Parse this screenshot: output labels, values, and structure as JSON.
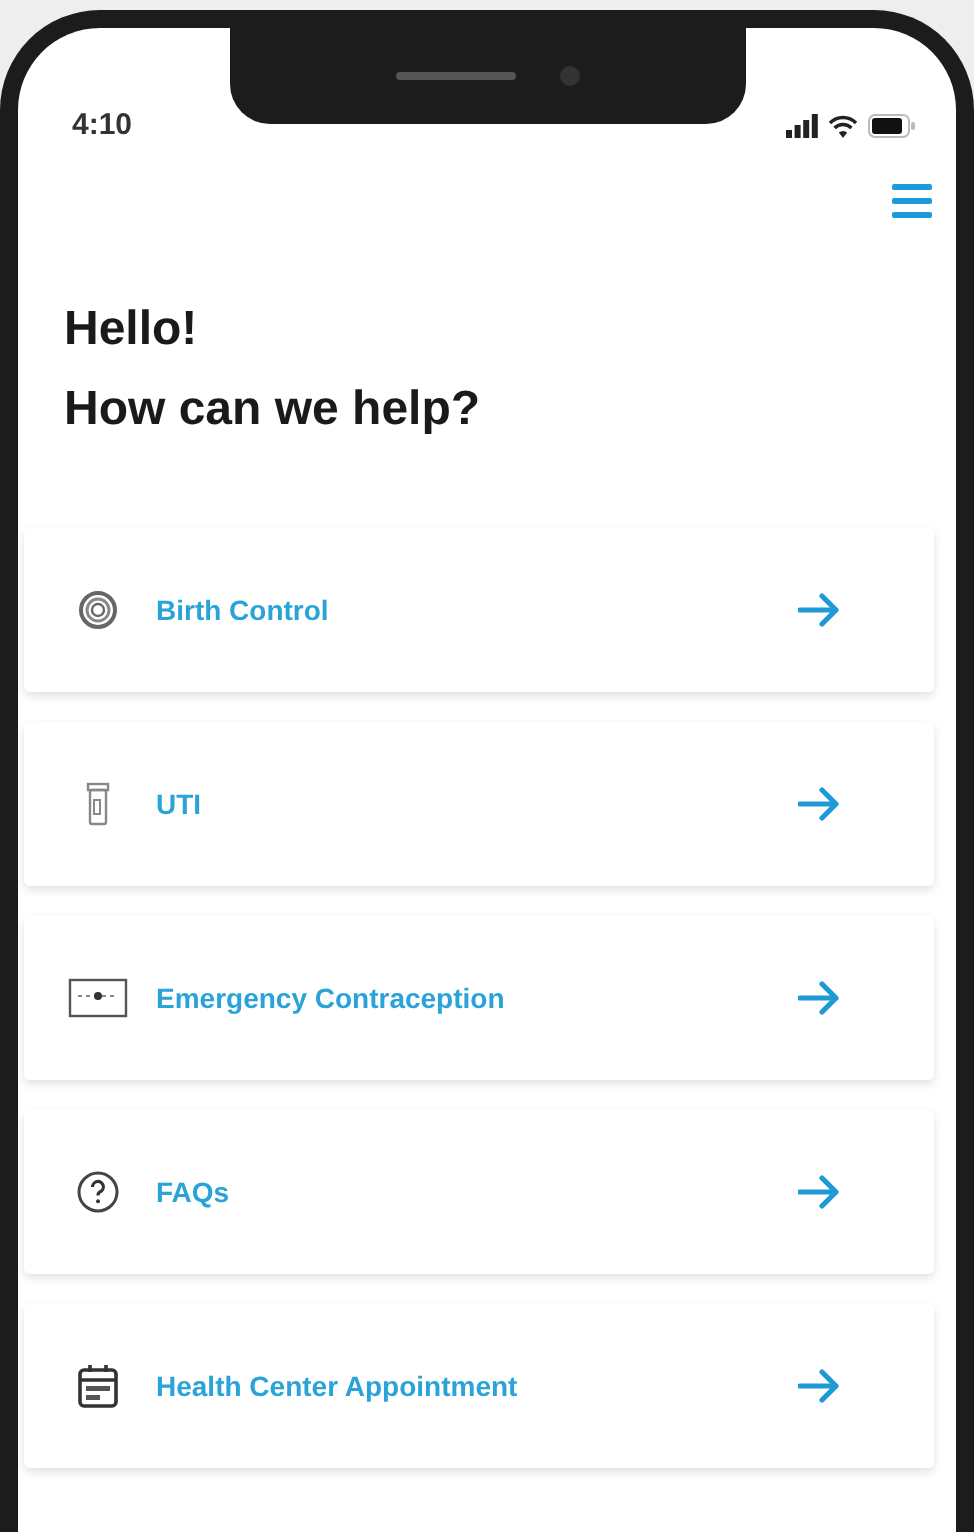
{
  "status_bar": {
    "time": "4:10"
  },
  "greeting": {
    "line_1": "Hello!",
    "line_2": "How can we help?"
  },
  "items": [
    {
      "label": "Birth Control",
      "kind": "ring"
    },
    {
      "label": "UTI",
      "kind": "vial"
    },
    {
      "label": "Emergency Contraception",
      "kind": "pill-card"
    },
    {
      "label": "FAQs",
      "kind": "question"
    },
    {
      "label": "Health Center Appointment",
      "kind": "calendar"
    }
  ]
}
